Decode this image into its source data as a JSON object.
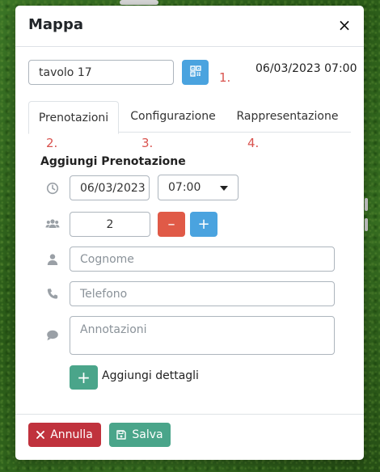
{
  "modal": {
    "title": "Mappa",
    "close_label": "×"
  },
  "table": {
    "name_value": "tavolo 17",
    "datetime": "06/03/2023 07:00"
  },
  "steps": [
    "1.",
    "2.",
    "3.",
    "4."
  ],
  "tabs": [
    {
      "label": "Prenotazioni",
      "active": true
    },
    {
      "label": "Configurazione",
      "active": false
    },
    {
      "label": "Rappresentazione",
      "active": false
    }
  ],
  "form": {
    "section_title": "Aggiungi Prenotazione",
    "date_value": "06/03/2023",
    "time_value": "07:00",
    "guests_value": "2",
    "minus_label": "–",
    "plus_label": "+",
    "surname_placeholder": "Cognome",
    "phone_placeholder": "Telefono",
    "notes_placeholder": "Annotazioni",
    "add_details_label": "Aggiungi dettagli",
    "add_details_plus": "+"
  },
  "footer": {
    "cancel_label": "Annulla",
    "save_label": "Salva"
  },
  "icons": {
    "clock": "clock-icon",
    "users": "users-icon",
    "user": "user-icon",
    "phone": "phone-icon",
    "comment": "comment-icon",
    "qr": "qrcode-icon",
    "caret": "caret-down-icon",
    "x": "x-icon",
    "save": "floppy-disk-icon"
  },
  "colors": {
    "primary": "#4aa3df",
    "danger": "#e05a47",
    "success": "#4aa58a",
    "cancel": "#c0323d",
    "step": "#d9534f"
  }
}
